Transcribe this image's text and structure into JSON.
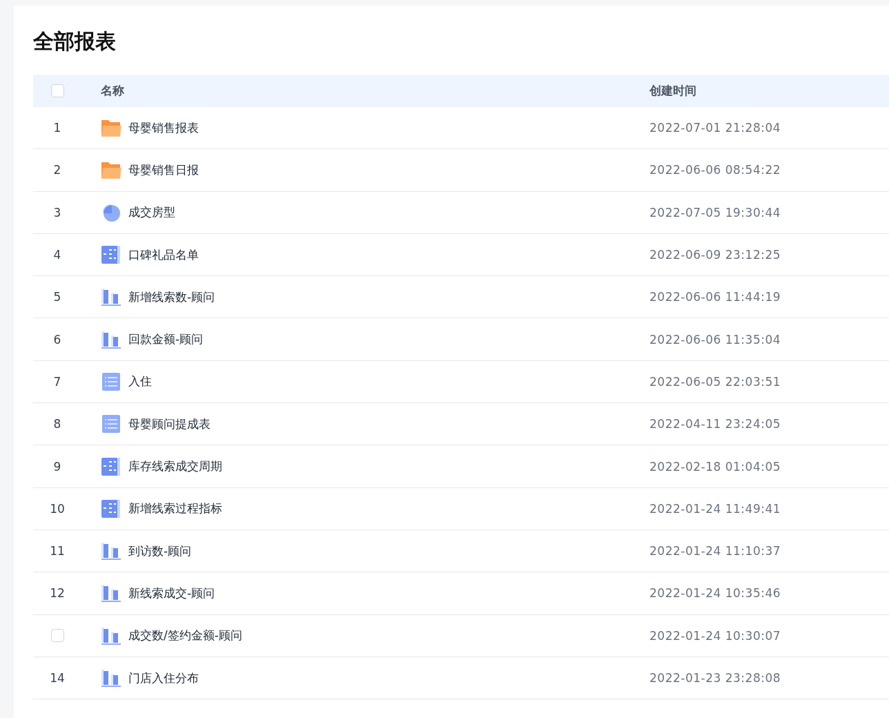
{
  "title": "全部报表",
  "table": {
    "header_checkbox": {
      "checked": false
    },
    "columns": [
      "名称",
      "创建时间"
    ],
    "rows": [
      {
        "marker": {
          "kind": "number",
          "text": "1"
        },
        "kind": "folder",
        "name": "母婴销售报表",
        "created": "2022-07-01 21:28:04"
      },
      {
        "marker": {
          "kind": "number",
          "text": "2"
        },
        "kind": "folder",
        "name": "母婴销售日报",
        "created": "2022-06-06 08:54:22"
      },
      {
        "marker": {
          "kind": "number",
          "text": "3"
        },
        "kind": "pie",
        "name": "成交房型",
        "created": "2022-07-05 19:30:44"
      },
      {
        "marker": {
          "kind": "number",
          "text": "4"
        },
        "kind": "grid",
        "name": "口碑礼品名单",
        "created": "2022-06-09 23:12:25"
      },
      {
        "marker": {
          "kind": "number",
          "text": "5"
        },
        "kind": "bar",
        "name": "新增线索数-顾问",
        "created": "2022-06-06 11:44:19"
      },
      {
        "marker": {
          "kind": "number",
          "text": "6"
        },
        "kind": "bar",
        "name": "回款金额-顾问",
        "created": "2022-06-06 11:35:04"
      },
      {
        "marker": {
          "kind": "number",
          "text": "7"
        },
        "kind": "list",
        "name": "入住",
        "created": "2022-06-05 22:03:51"
      },
      {
        "marker": {
          "kind": "number",
          "text": "8"
        },
        "kind": "list",
        "name": "母婴顾问提成表",
        "created": "2022-04-11 23:24:05"
      },
      {
        "marker": {
          "kind": "number",
          "text": "9"
        },
        "kind": "grid",
        "name": "库存线索成交周期",
        "created": "2022-02-18 01:04:05"
      },
      {
        "marker": {
          "kind": "number",
          "text": "10"
        },
        "kind": "grid",
        "name": "新增线索过程指标",
        "created": "2022-01-24 11:49:41"
      },
      {
        "marker": {
          "kind": "number",
          "text": "11"
        },
        "kind": "bar",
        "name": "到访数-顾问",
        "created": "2022-01-24 11:10:37"
      },
      {
        "marker": {
          "kind": "number",
          "text": "12"
        },
        "kind": "bar",
        "name": "新线索成交-顾问",
        "created": "2022-01-24 10:35:46"
      },
      {
        "marker": {
          "kind": "checkbox",
          "checked": false
        },
        "kind": "bar",
        "name": "成交数/签约金额-顾问",
        "created": "2022-01-24 10:30:07"
      },
      {
        "marker": {
          "kind": "number",
          "text": "14"
        },
        "kind": "bar",
        "name": "门店入住分布",
        "created": "2022-01-23 23:28:08"
      }
    ]
  }
}
